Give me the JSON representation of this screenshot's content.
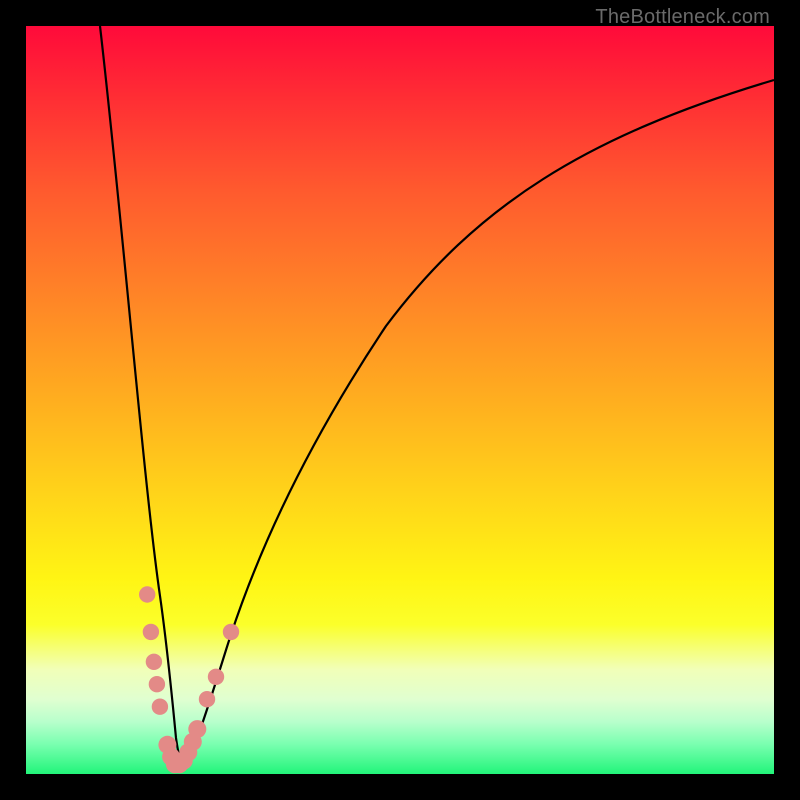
{
  "watermark": "TheBottleneck.com",
  "colors": {
    "frame": "#000000",
    "gradient_top": "#ff0a3a",
    "gradient_bottom": "#22f57a",
    "curve": "#000000",
    "bead": "#e38a87"
  },
  "chart_data": {
    "type": "line",
    "title": "",
    "xlabel": "",
    "ylabel": "",
    "xlim": [
      0,
      100
    ],
    "ylim": [
      0,
      100
    ],
    "annotations": [
      "TheBottleneck.com"
    ],
    "series": [
      {
        "name": "left_branch",
        "x": [
          10,
          12,
          14,
          16,
          17,
          18,
          18.7,
          19.3,
          19.8
        ],
        "y": [
          100,
          78,
          54,
          28,
          17,
          8.5,
          4.4,
          2.2,
          1.3
        ]
      },
      {
        "name": "right_branch",
        "x": [
          20.6,
          21.5,
          23,
          25,
          28,
          32,
          38,
          46,
          56,
          68,
          82,
          100
        ],
        "y": [
          1.3,
          2.6,
          6,
          12,
          21,
          32,
          45,
          58,
          70,
          80,
          88,
          93
        ]
      }
    ],
    "markers": [
      {
        "x": 16.2,
        "y": 24.0,
        "r": 1.1
      },
      {
        "x": 16.7,
        "y": 19.0,
        "r": 1.1
      },
      {
        "x": 17.1,
        "y": 15.0,
        "r": 1.1
      },
      {
        "x": 17.5,
        "y": 12.0,
        "r": 1.1
      },
      {
        "x": 17.9,
        "y": 9.0,
        "r": 1.1
      },
      {
        "x": 18.9,
        "y": 3.9,
        "r": 1.2
      },
      {
        "x": 19.4,
        "y": 2.3,
        "r": 1.2
      },
      {
        "x": 19.9,
        "y": 1.3,
        "r": 1.2
      },
      {
        "x": 20.5,
        "y": 1.3,
        "r": 1.2
      },
      {
        "x": 21.1,
        "y": 1.8,
        "r": 1.2
      },
      {
        "x": 21.7,
        "y": 2.9,
        "r": 1.2
      },
      {
        "x": 22.3,
        "y": 4.3,
        "r": 1.2
      },
      {
        "x": 22.9,
        "y": 6.0,
        "r": 1.2
      },
      {
        "x": 24.2,
        "y": 10.0,
        "r": 1.1
      },
      {
        "x": 25.4,
        "y": 13.0,
        "r": 1.1
      },
      {
        "x": 27.4,
        "y": 19.0,
        "r": 1.1
      }
    ]
  }
}
